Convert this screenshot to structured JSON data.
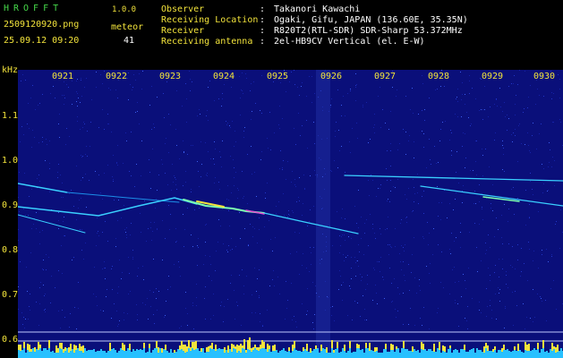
{
  "header": {
    "brand": "HROFFT",
    "version": "1.0.0",
    "filename": "2509120920.png",
    "datetime": "25.09.12 09:20",
    "meteor_label": "meteor",
    "meteor_count": "41",
    "info": [
      {
        "key": "Observer",
        "sep": ":",
        "value": "Takanori Kawachi"
      },
      {
        "key": "Receiving Location",
        "sep": ":",
        "value": "Ogaki, Gifu, JAPAN (136.60E, 35.35N)"
      },
      {
        "key": "Receiver",
        "sep": ":",
        "value": "R820T2(RTL-SDR) SDR-Sharp 53.372MHz"
      },
      {
        "key": "Receiving antenna",
        "sep": ":",
        "value": "2el-HB9CV Vertical (el. E-W)"
      }
    ]
  },
  "spectrogram": {
    "y_unit": "kHz",
    "y_ticks": [
      "1.1",
      "1.0",
      "0.9",
      "0.8",
      "0.7",
      "0.6"
    ],
    "x_ticks": [
      "0921",
      "0922",
      "0923",
      "0924",
      "0925",
      "0926",
      "0927",
      "0928",
      "0929",
      "0930"
    ],
    "colors": {
      "background": "#0a0f7a",
      "trace": "#3ad0ff",
      "level": "#f2e33b",
      "level_base": "#27c0ff"
    }
  }
}
